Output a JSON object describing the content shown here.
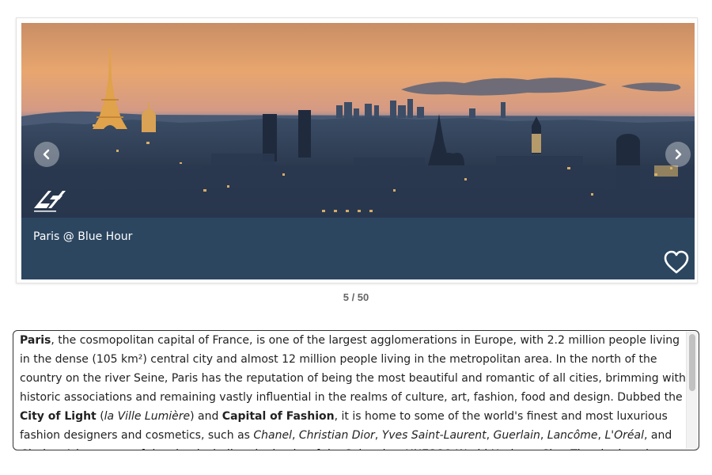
{
  "gallery": {
    "caption": "Paris @ Blue Hour",
    "counter": "5 / 50",
    "image_subject": "Paris skyline at dusk with Eiffel Tower",
    "icons": {
      "prev": "chevron-left-icon",
      "next": "chevron-right-icon",
      "favorite": "heart-outline-icon",
      "logo": "photographer-logo"
    },
    "colors": {
      "caption_bar": "#2c4660",
      "caption_text": "#ffffff",
      "sky_top": "#e8a66e",
      "sky_bottom": "#2f4a6c"
    }
  },
  "description": {
    "segments": [
      {
        "text": "Paris",
        "style": "bold"
      },
      {
        "text": ", the cosmopolitan capital of France, is one of the largest agglomerations in Europe, with 2.2 million people living in the dense (105 km²) central city and almost 12 million people living in the metropolitan area. In the north of the country on the river Seine, Paris has the reputation of being the most beautiful and romantic of all cities, brimming with historic associations and remaining vastly influential in the realms of culture, art, fashion, food and design. Dubbed the ",
        "style": "normal"
      },
      {
        "text": "City of Light",
        "style": "bold"
      },
      {
        "text": " (",
        "style": "normal"
      },
      {
        "text": "la Ville Lumière",
        "style": "italic"
      },
      {
        "text": ") and ",
        "style": "normal"
      },
      {
        "text": "Capital of Fashion",
        "style": "bold"
      },
      {
        "text": ", it is home to some of the world's finest and most luxurious fashion designers and cosmetics, such as ",
        "style": "normal"
      },
      {
        "text": "Chanel",
        "style": "italic"
      },
      {
        "text": ", ",
        "style": "normal"
      },
      {
        "text": "Christian Dior",
        "style": "italic"
      },
      {
        "text": ", ",
        "style": "normal"
      },
      {
        "text": "Yves Saint-Laurent",
        "style": "italic"
      },
      {
        "text": ", ",
        "style": "normal"
      },
      {
        "text": "Guerlain",
        "style": "italic"
      },
      {
        "text": ", ",
        "style": "normal"
      },
      {
        "text": "Lancôme",
        "style": "italic"
      },
      {
        "text": ", ",
        "style": "normal"
      },
      {
        "text": "L'Oréal",
        "style": "italic"
      },
      {
        "text": ", and ",
        "style": "normal"
      },
      {
        "text": "Clarins",
        "style": "italic"
      },
      {
        "text": ". A large part of the city, including the banks of the Seine, is a UNESCO World Heritage Site. The city has the second highest number of Michelin-starred restaurants in the world (after Tokyo) and",
        "style": "normal"
      }
    ]
  }
}
